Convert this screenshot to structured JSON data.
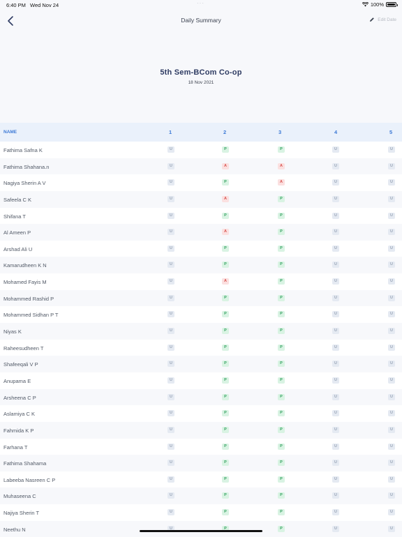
{
  "status_bar": {
    "time": "6:40 PM",
    "date": "Wed Nov 24",
    "battery": "100%"
  },
  "nav": {
    "title": "Daily Summary",
    "edit_label": "Edit Date"
  },
  "header": {
    "class_name": "5th Sem-BCom Co-op",
    "date": "18 Nov 2021"
  },
  "table": {
    "name_header": "NAME",
    "periods": [
      "1",
      "2",
      "3",
      "4",
      "5"
    ],
    "rows": [
      {
        "name": "Fathima Safna K",
        "marks": [
          "U",
          "P",
          "P",
          "U",
          "U"
        ]
      },
      {
        "name": "Fathima Shahana.n",
        "marks": [
          "U",
          "A",
          "A",
          "U",
          "U"
        ]
      },
      {
        "name": "Nagiya Sherin A V",
        "marks": [
          "U",
          "P",
          "A",
          "U",
          "U"
        ]
      },
      {
        "name": "Safeela C K",
        "marks": [
          "U",
          "A",
          "P",
          "U",
          "U"
        ]
      },
      {
        "name": "Shifana T",
        "marks": [
          "U",
          "P",
          "P",
          "U",
          "U"
        ]
      },
      {
        "name": "Al Ameen P",
        "marks": [
          "U",
          "A",
          "P",
          "U",
          "U"
        ]
      },
      {
        "name": "Arshad Ali U",
        "marks": [
          "U",
          "P",
          "P",
          "U",
          "U"
        ]
      },
      {
        "name": "Kamarudheen K N",
        "marks": [
          "U",
          "P",
          "P",
          "U",
          "U"
        ]
      },
      {
        "name": "Mohamed Fayis M",
        "marks": [
          "U",
          "A",
          "P",
          "U",
          "U"
        ]
      },
      {
        "name": "Mohammed Rashid P",
        "marks": [
          "U",
          "P",
          "P",
          "U",
          "U"
        ]
      },
      {
        "name": "Mohammed Sidhan P T",
        "marks": [
          "U",
          "P",
          "P",
          "U",
          "U"
        ]
      },
      {
        "name": "Niyas K",
        "marks": [
          "U",
          "P",
          "P",
          "U",
          "U"
        ]
      },
      {
        "name": "Raheesudheen T",
        "marks": [
          "U",
          "P",
          "P",
          "U",
          "U"
        ]
      },
      {
        "name": "Shafeeqali V P",
        "marks": [
          "U",
          "P",
          "P",
          "U",
          "U"
        ]
      },
      {
        "name": "Anupama E",
        "marks": [
          "U",
          "P",
          "P",
          "U",
          "U"
        ]
      },
      {
        "name": "Arsheena C P",
        "marks": [
          "U",
          "P",
          "P",
          "U",
          "U"
        ]
      },
      {
        "name": "Aslamiya C K",
        "marks": [
          "U",
          "P",
          "P",
          "U",
          "U"
        ]
      },
      {
        "name": "Fahmida K P",
        "marks": [
          "U",
          "P",
          "P",
          "U",
          "U"
        ]
      },
      {
        "name": "Farhana T",
        "marks": [
          "U",
          "P",
          "P",
          "U",
          "U"
        ]
      },
      {
        "name": "Fathima Shahama",
        "marks": [
          "U",
          "P",
          "P",
          "U",
          "U"
        ]
      },
      {
        "name": "Labeeba Nasreen C P",
        "marks": [
          "U",
          "P",
          "P",
          "U",
          "U"
        ]
      },
      {
        "name": "Muhaseena C",
        "marks": [
          "U",
          "P",
          "P",
          "U",
          "U"
        ]
      },
      {
        "name": "Najiya Sherin T",
        "marks": [
          "U",
          "P",
          "P",
          "U",
          "U"
        ]
      },
      {
        "name": "Neethu N",
        "marks": [
          "U",
          "P",
          "P",
          "U",
          "U"
        ]
      }
    ]
  }
}
